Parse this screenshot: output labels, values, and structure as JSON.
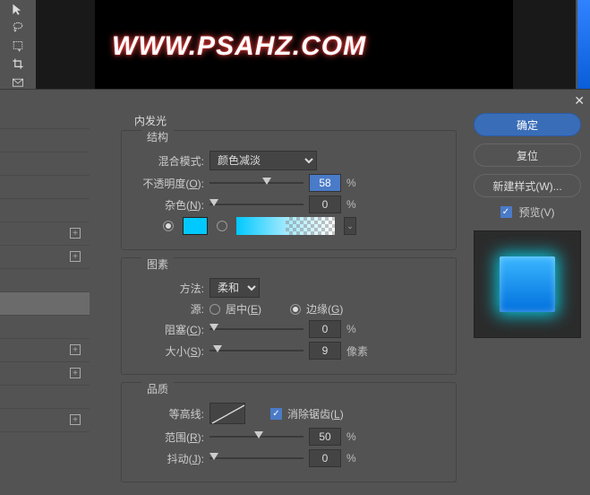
{
  "canvas_text": "WWW.PSAHZ.COM",
  "dialog": {
    "section_title": "内发光",
    "structure_legend": "结构",
    "blend_mode_label": "混合模式:",
    "blend_mode_value": "颜色减淡",
    "opacity_label": "不透明度(",
    "opacity_hotkey": "O",
    "close_paren": "):",
    "opacity_value": "58",
    "percent": "%",
    "noise_label": "杂色(",
    "noise_hotkey": "N",
    "noise_value": "0",
    "elements_legend": "图素",
    "technique_label": "方法:",
    "technique_value": "柔和",
    "source_label": "源:",
    "source_center": "居中(",
    "source_center_hk": "E",
    "source_edge": "边缘(",
    "source_edge_hk": "G",
    "source_close": ")",
    "choke_label": "阻塞(",
    "choke_hotkey": "C",
    "choke_value": "0",
    "size_label": "大小(",
    "size_hotkey": "S",
    "size_value": "9",
    "pixels": "像素",
    "quality_legend": "品质",
    "contour_label": "等高线:",
    "antialias": "消除锯齿(",
    "antialias_hk": "L",
    "range_label": "范围(",
    "range_hotkey": "R",
    "range_value": "50",
    "jitter_label": "抖动(",
    "jitter_hotkey": "J",
    "jitter_value": "0"
  },
  "buttons": {
    "ok": "确定",
    "reset": "复位",
    "new_style": "新建样式(W)...",
    "preview": "预览(V)"
  }
}
